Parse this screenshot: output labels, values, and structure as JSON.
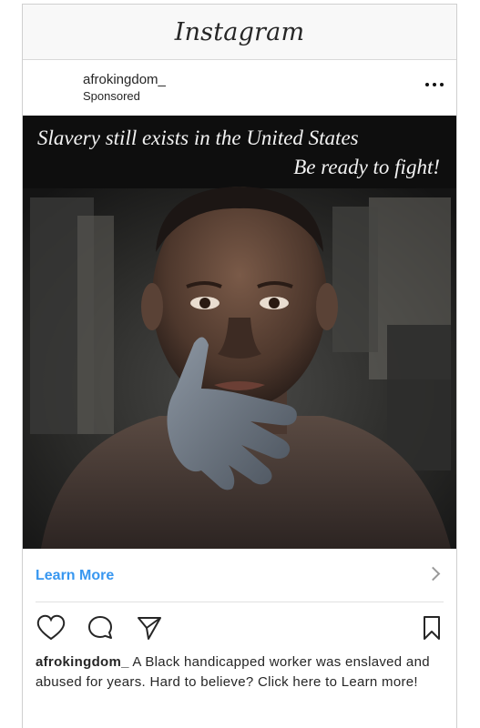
{
  "app": {
    "title": "Instagram"
  },
  "post": {
    "username": "afrokingdom_",
    "label": "Sponsored",
    "more_icon": "more-options-icon",
    "image": {
      "headline": "Slavery still exists in the United States",
      "subline": "Be ready to fight!"
    },
    "cta": {
      "label": "Learn More",
      "color": "#3897f0"
    },
    "actions": [
      "heart-icon",
      "comment-icon",
      "share-icon",
      "bookmark-icon"
    ],
    "caption": {
      "user": "afrokingdom_",
      "text": " A Black handicapped worker was enslaved and abused for years. Hard to believe? Click here to Learn more!"
    }
  }
}
